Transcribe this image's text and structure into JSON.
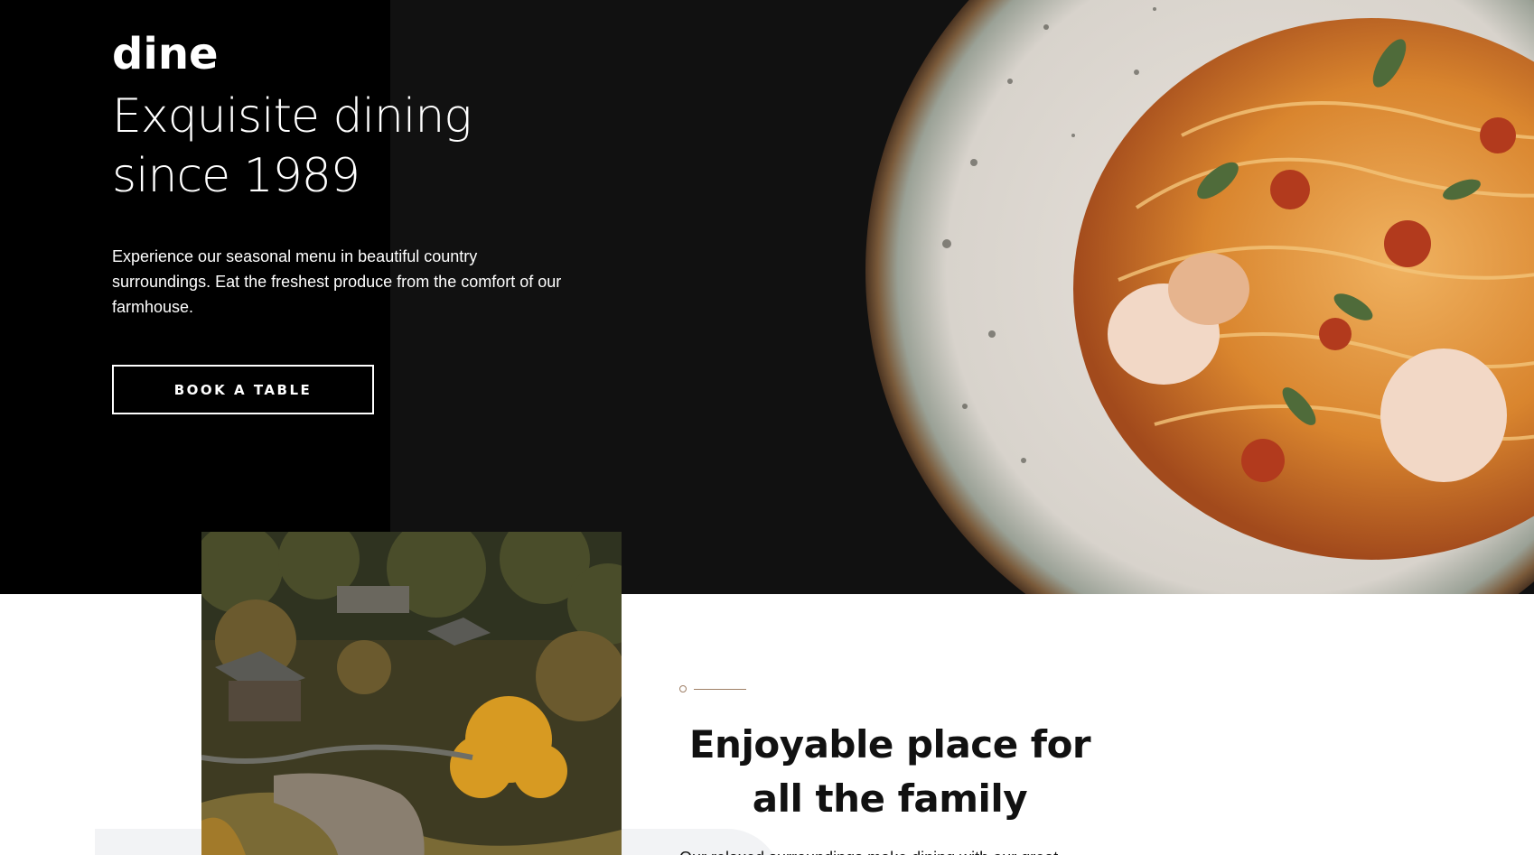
{
  "brand": {
    "logo": "dine"
  },
  "hero": {
    "headline_line1": "Exquisite dining",
    "headline_line2": "since 1989",
    "intro": "Experience our seasonal menu in beautiful country surroundings. Eat the freshest produce from the comfort of our farmhouse.",
    "cta_label": "BOOK A TABLE"
  },
  "family_section": {
    "title_line1": "Enjoyable place for",
    "title_line2": "all the family",
    "body": "Our relaxed surroundings make dining with our great"
  },
  "colors": {
    "hero_background": "#111111",
    "accent": "#9e7f66",
    "text_dark": "#111111"
  },
  "images": {
    "hero": "pasta-with-shrimp-dish",
    "section": "countryside-farmhouse-village"
  }
}
